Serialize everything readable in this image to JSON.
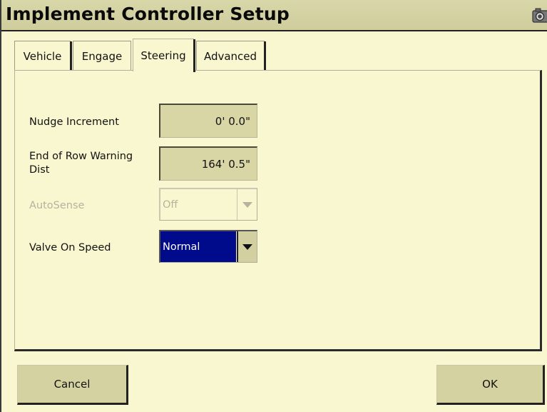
{
  "window": {
    "title": "Implement Controller Setup",
    "title_icon": "camera-icon"
  },
  "tabs": [
    {
      "label": "Vehicle",
      "active": false
    },
    {
      "label": "Engage",
      "active": false
    },
    {
      "label": "Steering",
      "active": true
    },
    {
      "label": "Advanced",
      "active": false
    }
  ],
  "settings": {
    "nudge_increment": {
      "label": "Nudge Increment",
      "value": "0' 0.0\""
    },
    "end_of_row": {
      "label_line1": "End of Row Warning",
      "label_line2": "Dist",
      "value": "164' 0.5\""
    },
    "autosense": {
      "label": "AutoSense",
      "value": "Off",
      "enabled": false
    },
    "valve_on_speed": {
      "label": "Valve On Speed",
      "value": "Normal",
      "enabled": true
    }
  },
  "footer": {
    "cancel_label": "Cancel",
    "ok_label": "OK"
  },
  "colors": {
    "background": "#f9f7cf",
    "title_bar": "#d3d1a0",
    "field": "#d9d6a6",
    "selected_value": "#000b8c"
  }
}
